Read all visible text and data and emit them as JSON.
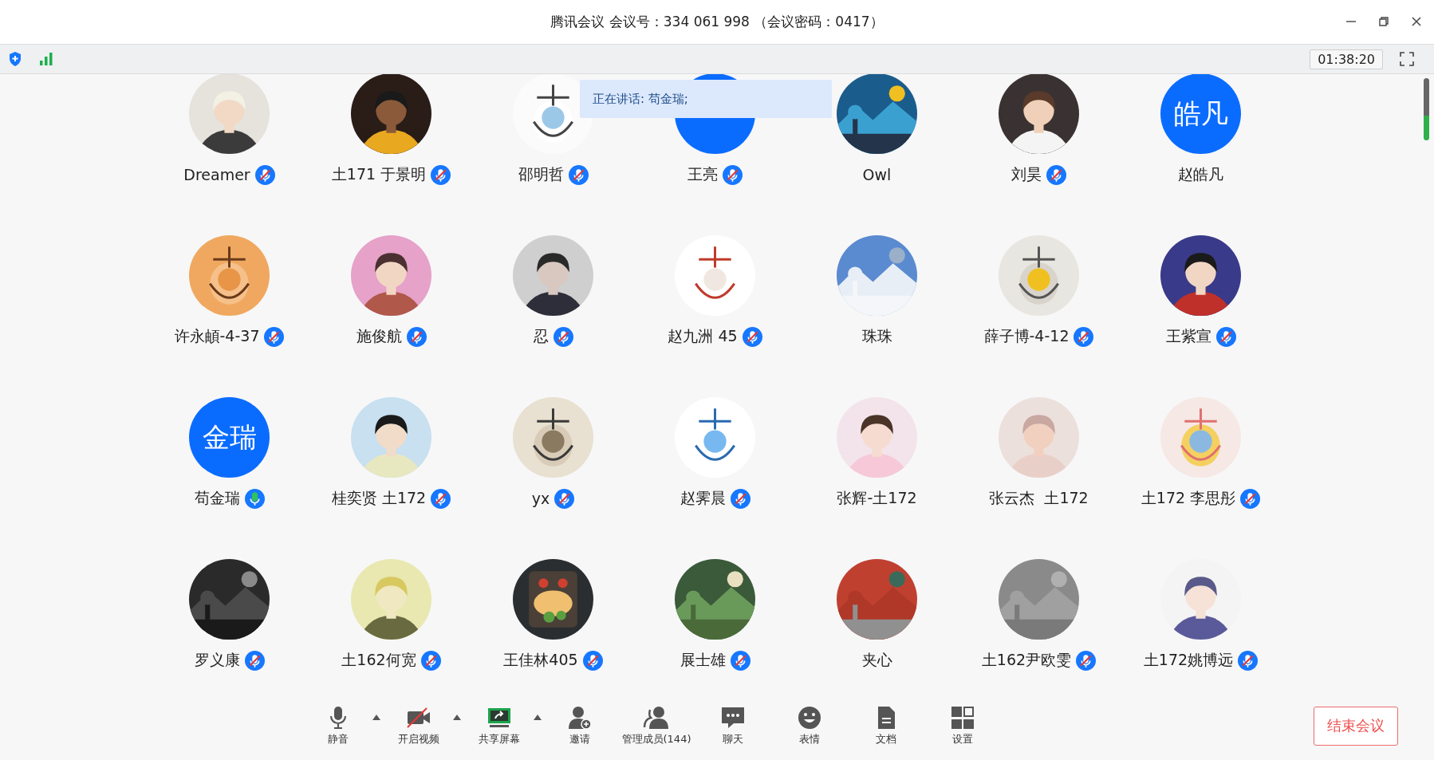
{
  "window": {
    "title": "腾讯会议 会议号：334 061 998 （会议密码：0417）"
  },
  "status_bar": {
    "timer": "01:38:20"
  },
  "speaking_banner": "正在讲话: 苟金瑞;",
  "participants": [
    {
      "name": "Dreamer",
      "muted": true,
      "speaking": false
    },
    {
      "name": "土171 于景明",
      "muted": true,
      "speaking": false
    },
    {
      "name": "邵明哲",
      "muted": true,
      "speaking": false
    },
    {
      "name": "王亮",
      "avatar": {
        "kind": "blank"
      },
      "muted": true,
      "speaking": false
    },
    {
      "name": "Owl",
      "muted": false,
      "speaking": false
    },
    {
      "name": "刘昊",
      "muted": true,
      "speaking": false
    },
    {
      "name": "赵皓凡",
      "avatar": {
        "kind": "initials",
        "text": "皓凡"
      },
      "muted": false,
      "speaking": false
    },
    {
      "name": "许永頔-4-37",
      "muted": true,
      "speaking": false
    },
    {
      "name": "施俊航",
      "muted": true,
      "speaking": false
    },
    {
      "name": "忍",
      "muted": true,
      "speaking": false
    },
    {
      "name": "赵九洲 45",
      "muted": true,
      "speaking": false
    },
    {
      "name": "珠珠",
      "muted": false,
      "speaking": false
    },
    {
      "name": "薛子博-4-12",
      "muted": true,
      "speaking": false
    },
    {
      "name": "王紫宣",
      "muted": true,
      "speaking": false
    },
    {
      "name": "苟金瑞",
      "avatar": {
        "kind": "initials",
        "text": "金瑞"
      },
      "muted": false,
      "speaking": true
    },
    {
      "name": "桂奕贤 土172",
      "muted": true,
      "speaking": false
    },
    {
      "name": "yx",
      "muted": true,
      "speaking": false
    },
    {
      "name": "赵霁晨",
      "muted": true,
      "speaking": false
    },
    {
      "name": "张辉-土172",
      "muted": false,
      "speaking": false
    },
    {
      "name": "张云杰  土172",
      "muted": false,
      "speaking": false
    },
    {
      "name": "土172 李思彤",
      "muted": true,
      "speaking": false
    },
    {
      "name": "罗义康",
      "muted": true,
      "speaking": false
    },
    {
      "name": "土162何宽",
      "muted": true,
      "speaking": false
    },
    {
      "name": "王佳林405",
      "muted": true,
      "speaking": false
    },
    {
      "name": "展士雄",
      "muted": true,
      "speaking": false
    },
    {
      "name": "夹心",
      "muted": false,
      "speaking": false
    },
    {
      "name": "土162尹欧雯",
      "muted": true,
      "speaking": false
    },
    {
      "name": "土172姚博远",
      "muted": true,
      "speaking": false
    }
  ],
  "toolbar": [
    {
      "kind": "mic",
      "label": "静音",
      "has_menu": true
    },
    {
      "kind": "video",
      "label": "开启视频",
      "has_menu": true
    },
    {
      "kind": "share",
      "label": "共享屏幕",
      "has_menu": true
    },
    {
      "kind": "invite",
      "label": "邀请",
      "has_menu": false
    },
    {
      "kind": "members",
      "label": "管理成员(144)",
      "has_menu": false
    },
    {
      "kind": "chat",
      "label": "聊天",
      "has_menu": false
    },
    {
      "kind": "emoji",
      "label": "表情",
      "has_menu": false
    },
    {
      "kind": "doc",
      "label": "文档",
      "has_menu": false
    },
    {
      "kind": "settings",
      "label": "设置",
      "has_menu": false
    }
  ],
  "end_button": "结束会议"
}
